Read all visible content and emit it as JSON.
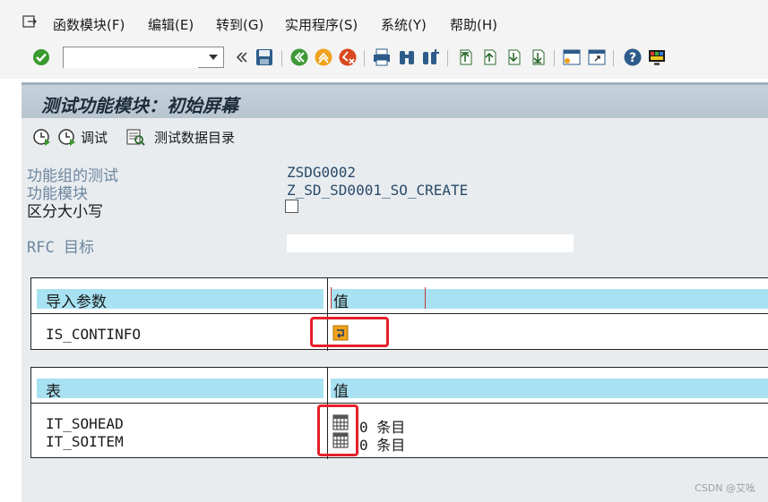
{
  "menu": {
    "items": [
      "函数模块(F)",
      "编辑(E)",
      "转到(G)",
      "实用程序(S)",
      "系统(Y)",
      "帮助(H)"
    ]
  },
  "toolbar": {
    "command_value": "",
    "icons": [
      "enter-check-icon",
      "command-dropdown-icon",
      "collapse-icon",
      "save-icon",
      "back-icon",
      "exit-icon",
      "cancel-icon",
      "print-icon",
      "find-icon",
      "find-next-icon",
      "first-page-icon",
      "prev-page-icon",
      "next-page-icon",
      "last-page-icon",
      "new-session-icon",
      "shortcut-icon",
      "help-icon",
      "customize-layout-icon"
    ]
  },
  "screen": {
    "title": "测试功能模块：初始屏幕",
    "app_toolbar": {
      "execute_label": "",
      "debug_label": "调试",
      "test_data_label": "测试数据目录"
    },
    "fields": {
      "function_group_label": "功能组的测试",
      "function_group_value": "ZSDG0002",
      "function_module_label": "功能模块",
      "function_module_value": "Z_SD_SD0001_SO_CREATE",
      "case_sensitive_label": "区分大小写",
      "case_sensitive_checked": false,
      "rfc_label": "RFC 目标",
      "rfc_value": ""
    },
    "import_table": {
      "col1_header": "导入参数",
      "col2_header": "值",
      "rows": [
        {
          "name": "IS_CONTINFO",
          "icon": "structure-edit-icon"
        }
      ]
    },
    "tables_table": {
      "col1_header": "表",
      "col2_header": "值",
      "rows": [
        {
          "name": "IT_SOHEAD",
          "count": "0",
          "unit": "条目"
        },
        {
          "name": "IT_SOITEM",
          "count": "0",
          "unit": "条目"
        }
      ]
    },
    "watermark": "CSDN @艾吆"
  },
  "colors": {
    "header_cyan": "#a8e2f2",
    "label_blue": "#6e86a0",
    "highlight_red": "#e5202a",
    "title_bar": "#b7c5d0"
  }
}
